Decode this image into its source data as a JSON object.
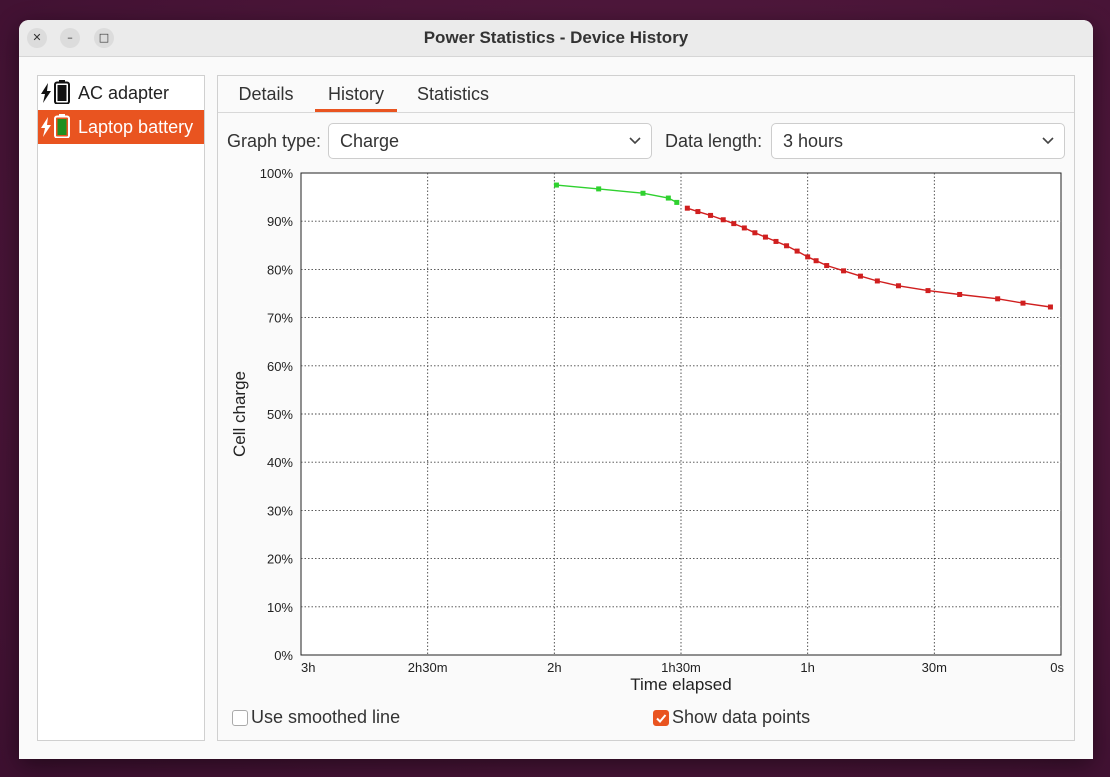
{
  "window": {
    "title": "Power Statistics - Device History"
  },
  "devices": [
    {
      "label": "AC adapter",
      "selected": false
    },
    {
      "label": "Laptop battery",
      "selected": true
    }
  ],
  "tabs": [
    {
      "label": "Details"
    },
    {
      "label": "History",
      "active": true
    },
    {
      "label": "Statistics"
    }
  ],
  "controls": {
    "graph_type_label": "Graph type:",
    "graph_type_value": "Charge",
    "data_length_label": "Data length:",
    "data_length_value": "3 hours"
  },
  "options": {
    "smoothed_label": "Use smoothed line",
    "smoothed_checked": false,
    "points_label": "Show data points",
    "points_checked": true
  },
  "colors": {
    "accent": "#e95420",
    "charging": "#2fd12f",
    "discharging": "#d01f1f"
  },
  "chart_data": {
    "type": "line",
    "xlabel": "Time elapsed",
    "ylabel": "Cell charge",
    "xlim": [
      180,
      0
    ],
    "ylim": [
      0,
      100
    ],
    "x_unit": "minutes ago",
    "x_ticks": [
      {
        "v": 180,
        "label": "3h"
      },
      {
        "v": 150,
        "label": "2h30m"
      },
      {
        "v": 120,
        "label": "2h"
      },
      {
        "v": 90,
        "label": "1h30m"
      },
      {
        "v": 60,
        "label": "1h"
      },
      {
        "v": 30,
        "label": "30m"
      },
      {
        "v": 0,
        "label": "0s"
      }
    ],
    "y_ticks": [
      {
        "v": 100,
        "label": "100%"
      },
      {
        "v": 90,
        "label": "90%"
      },
      {
        "v": 80,
        "label": "80%"
      },
      {
        "v": 70,
        "label": "70%"
      },
      {
        "v": 60,
        "label": "60%"
      },
      {
        "v": 50,
        "label": "50%"
      },
      {
        "v": 40,
        "label": "40%"
      },
      {
        "v": 30,
        "label": "30%"
      },
      {
        "v": 20,
        "label": "20%"
      },
      {
        "v": 10,
        "label": "10%"
      },
      {
        "v": 0,
        "label": "0%"
      }
    ],
    "grid": true,
    "series": [
      {
        "state": "charging",
        "x": [
          119.5,
          109.5,
          99,
          93,
          91
        ],
        "y": [
          97.5,
          96.7,
          95.8,
          94.8,
          93.9
        ]
      },
      {
        "state": "discharging",
        "x": [
          88.5,
          86,
          83,
          80,
          77.5,
          75,
          72.5,
          70,
          67.5,
          65,
          62.5,
          60,
          58,
          55.5,
          51.5,
          47.5,
          43.5,
          38.5,
          31.5,
          24,
          15,
          9,
          2.5
        ],
        "y": [
          92.7,
          92.0,
          91.2,
          90.3,
          89.5,
          88.6,
          87.6,
          86.7,
          85.8,
          84.9,
          83.8,
          82.6,
          81.8,
          80.8,
          79.7,
          78.6,
          77.6,
          76.6,
          75.6,
          74.8,
          73.9,
          73.0,
          72.2
        ]
      }
    ]
  }
}
